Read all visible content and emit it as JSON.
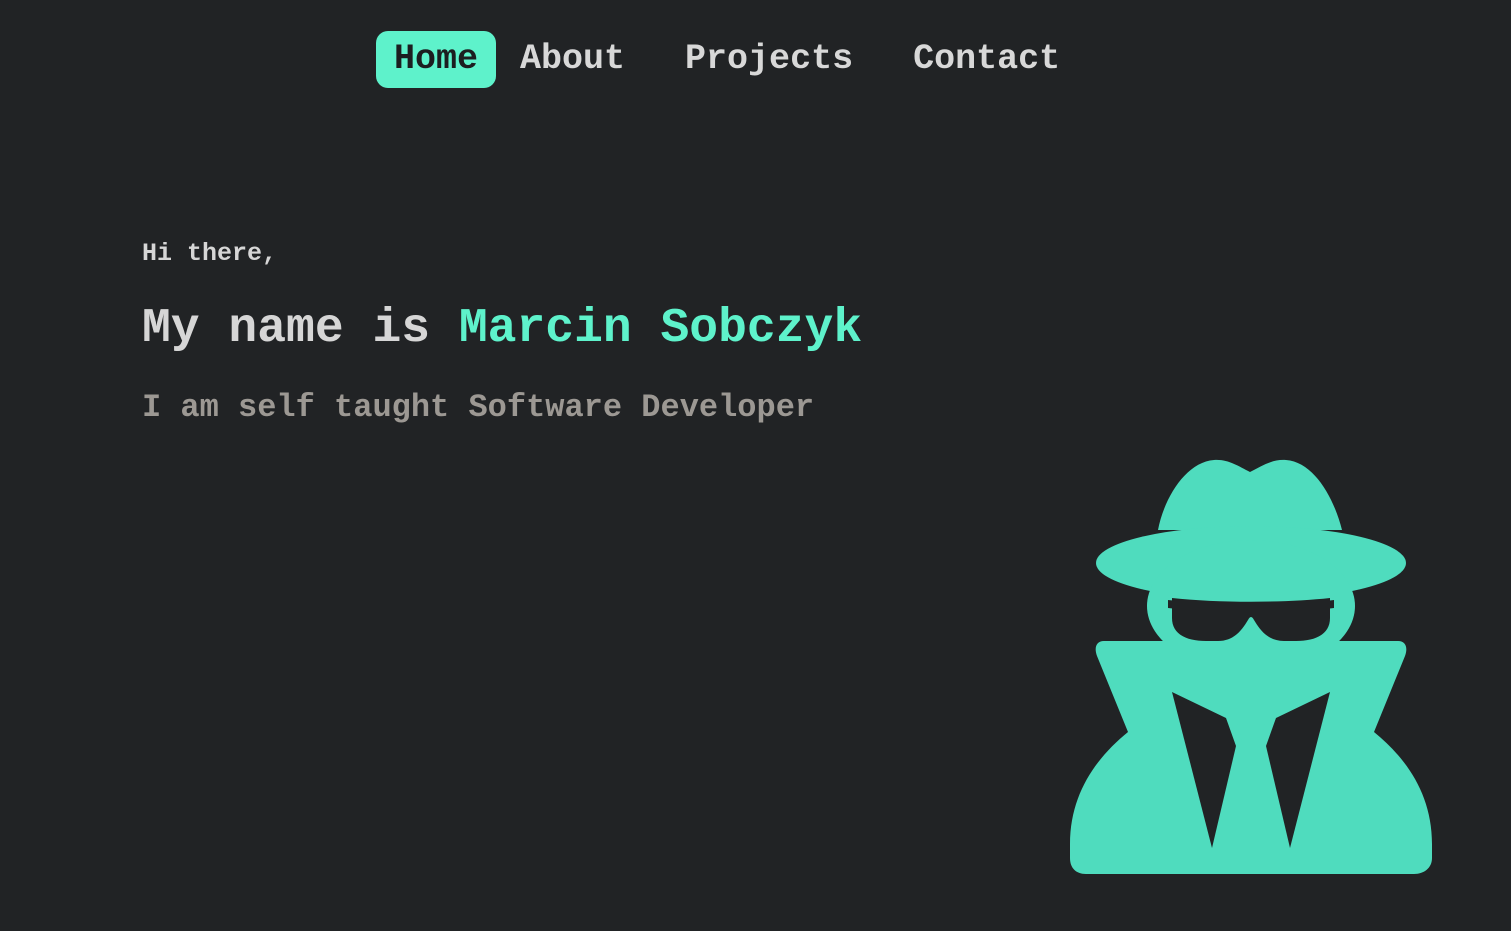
{
  "nav": {
    "items": [
      {
        "label": "Home",
        "active": true
      },
      {
        "label": "About",
        "active": false
      },
      {
        "label": "Projects",
        "active": false
      },
      {
        "label": "Contact",
        "active": false
      }
    ]
  },
  "hero": {
    "greeting": "Hi there,",
    "headline_prefix": "My name is ",
    "name": "Marcin Sobczyk",
    "tagline": "I am self taught Software Developer"
  },
  "illustration": {
    "icon": "user-secret-icon",
    "color": "#4fdcbe"
  },
  "colors": {
    "background": "#212325",
    "accent": "#5ef2cb",
    "text": "#d6d6d6",
    "muted": "#9c9893"
  }
}
